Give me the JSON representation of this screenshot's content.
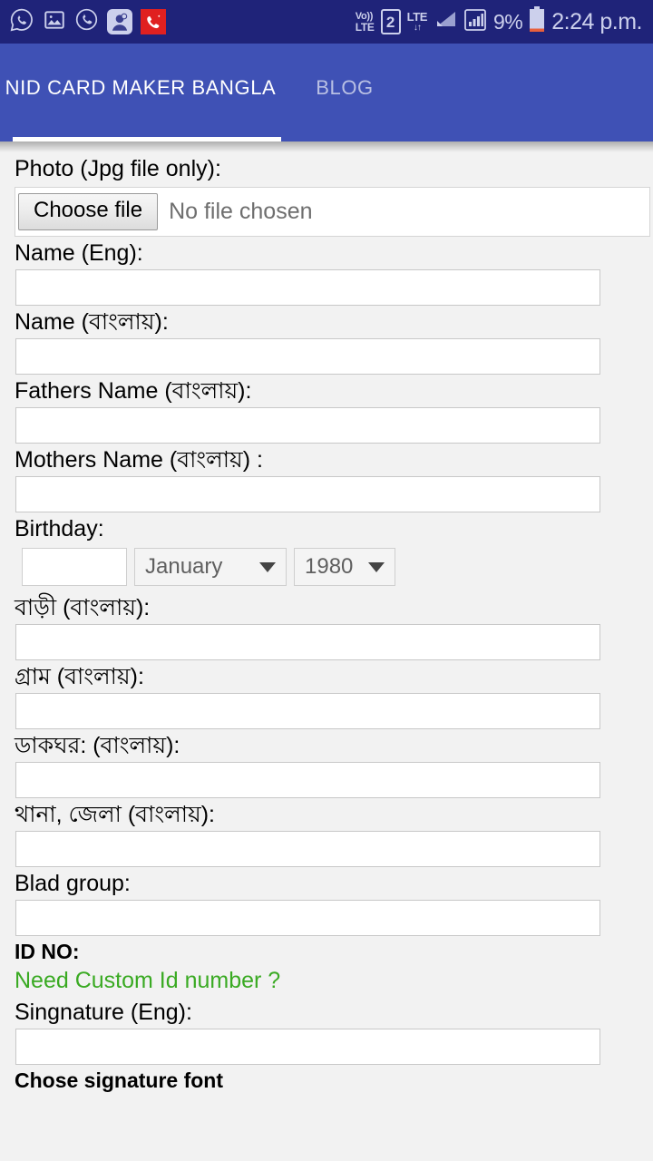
{
  "status_bar": {
    "time": "2:24 p.m.",
    "battery_percent": "9%",
    "sim_slot": "2",
    "volte_top": "Vo))",
    "volte_bottom": "LTE",
    "lte_label": "LTE",
    "lte_arrows": "↓↑",
    "left_icons": [
      "whatsapp-icon",
      "gallery-image-icon",
      "phone-call-icon",
      "app-badge-icon",
      "missed-call-icon"
    ],
    "right_icons": [
      "volte-icon",
      "sim-card-icon",
      "lte-data-icon",
      "signal-triangle-icon",
      "signal-bars-icon",
      "battery-icon"
    ],
    "colors": {
      "background": "#1f2379",
      "foreground": "#ccd0ec",
      "missed_call": "#e02020",
      "battery_low": "#e8603c"
    }
  },
  "app_bar": {
    "color": "#3f51b5",
    "tabs": [
      {
        "label": "NID CARD MAKER BANGLA",
        "active": true
      },
      {
        "label": "BLOG",
        "active": false
      }
    ]
  },
  "form": {
    "photo": {
      "label": "Photo (Jpg file only):",
      "button_label": "Choose file",
      "status_text": "No file chosen"
    },
    "name_eng": {
      "label": "Name (Eng):",
      "value": ""
    },
    "name_bn": {
      "label": "Name (বাংলায়):",
      "value": ""
    },
    "father_name": {
      "label": "Fathers Name (বাংলায়):",
      "value": ""
    },
    "mother_name": {
      "label": "Mothers Name (বাংলায়) :",
      "value": ""
    },
    "birthday": {
      "label": "Birthday:",
      "day_value": "",
      "month_value": "January",
      "year_value": "1980"
    },
    "house_bn": {
      "label": "বাড়ী (বাংলায়):",
      "value": ""
    },
    "village_bn": {
      "label": "গ্রাম (বাংলায়):",
      "value": ""
    },
    "post_office_bn": {
      "label": "ডাকঘর: (বাংলায়):",
      "value": ""
    },
    "thana_district_bn": {
      "label": "থানা, জেলা (বাংলায়):",
      "value": ""
    },
    "blood_group": {
      "label": "Blad group:",
      "value": ""
    },
    "id_no": {
      "label": "ID NO:"
    },
    "custom_id_link": {
      "label": "Need Custom Id number ?",
      "color": "#3aaa23"
    },
    "signature": {
      "label": "Singnature (Eng):",
      "value": ""
    },
    "signature_font": {
      "label": "Chose signature font"
    }
  }
}
